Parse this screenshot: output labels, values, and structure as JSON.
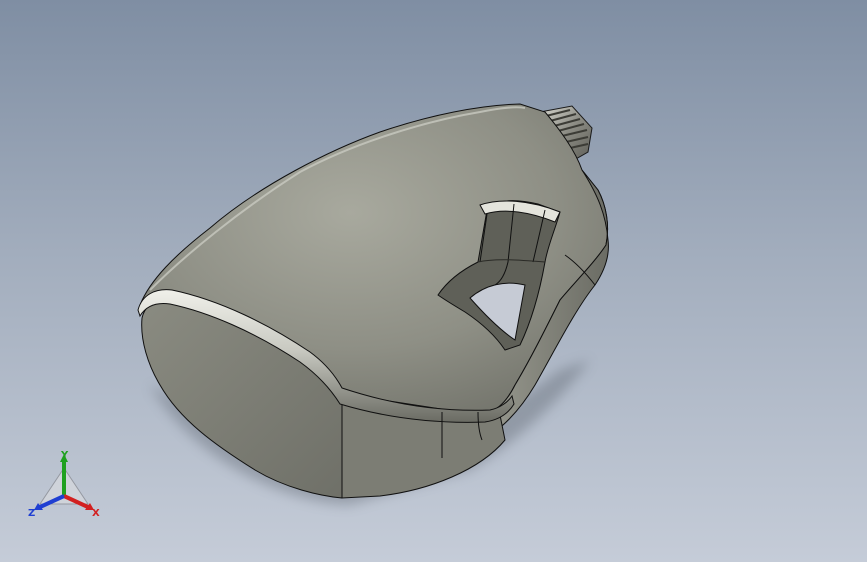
{
  "viewport": {
    "background_top": "#7f8ea3",
    "background_bottom": "#c5ccd8"
  },
  "model": {
    "body_color": "#8e8f86",
    "shadow_color": "#5b5c55",
    "highlight_color": "#e6e6de",
    "edge_color": "#101010"
  },
  "triad": {
    "x_label": "X",
    "y_label": "Y",
    "z_label": "Z",
    "x_color": "#d22020",
    "y_color": "#1fa01f",
    "z_color": "#1f3fd2"
  }
}
